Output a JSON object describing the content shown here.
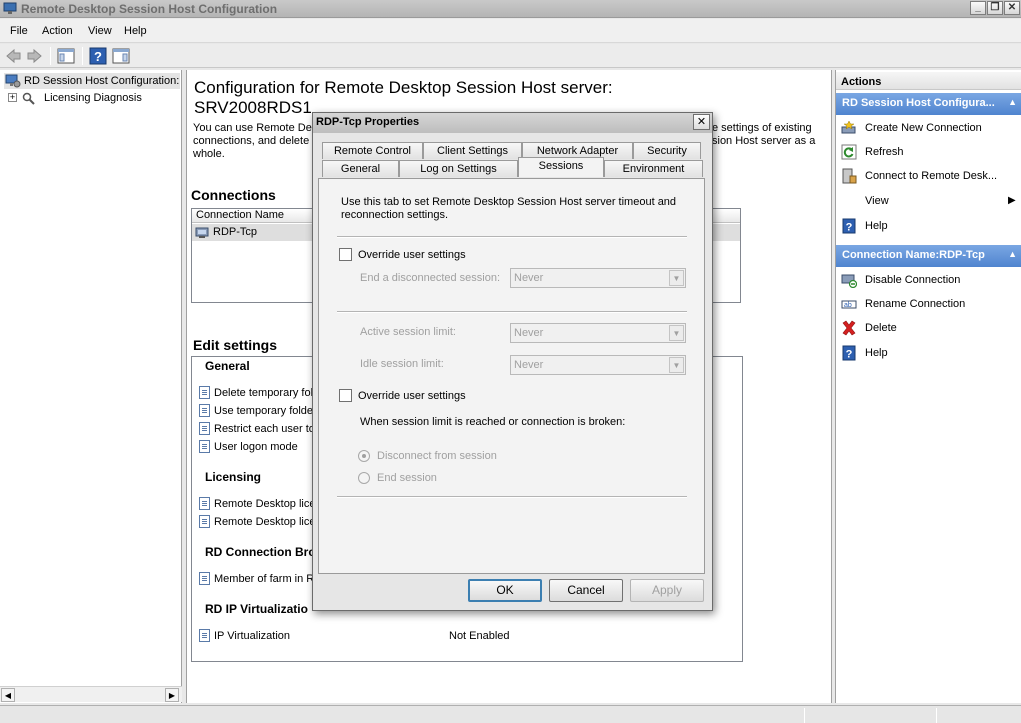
{
  "window": {
    "title": "Remote Desktop Session Host Configuration",
    "buttons": {
      "minimize": "_",
      "restore": "❐",
      "close": "✕"
    }
  },
  "menu": [
    "File",
    "Action",
    "View",
    "Help"
  ],
  "tree": {
    "root": "RD Session Host Configuration:",
    "child": "Licensing Diagnosis"
  },
  "center": {
    "title": "Configuration for Remote Desktop Session Host server:",
    "server": "SRV2008RDS1",
    "desc_left": "You can use Remote De\nconnections, and delete\nwhole.",
    "desc_right": "e settings of existing\nsion Host server as a",
    "connections_heading": "Connections",
    "connections_col": "Connection Name",
    "connection_row": "RDP-Tcp",
    "edit_heading": "Edit settings",
    "groups": [
      {
        "title": "General",
        "items": [
          "Delete temporary fol",
          "Use temporary folder",
          "Restrict each user to",
          "User logon mode"
        ]
      },
      {
        "title": "Licensing",
        "items": [
          "Remote Desktop lice",
          "Remote Desktop lice"
        ]
      },
      {
        "title": "RD Connection Bro",
        "items": [
          "Member of farm in R"
        ]
      },
      {
        "title": "RD IP Virtualizatio",
        "items": [
          "IP Virtualization"
        ]
      }
    ],
    "ip_virtualization_value": "Not Enabled"
  },
  "actions": {
    "header": "Actions",
    "group1": "RD Session Host Configura...",
    "group1_items": [
      "Create New Connection",
      "Refresh",
      "Connect to Remote Desk...",
      "View",
      "Help"
    ],
    "group2": "Connection Name:RDP-Tcp",
    "group2_items": [
      "Disable Connection",
      "Rename Connection",
      "Delete",
      "Help"
    ]
  },
  "dialog": {
    "title": "RDP-Tcp Properties",
    "tabs_row1": [
      "Remote Control",
      "Client Settings",
      "Network Adapter",
      "Security"
    ],
    "tabs_row2": [
      "General",
      "Log on Settings",
      "Sessions",
      "Environment"
    ],
    "active_tab": "Sessions",
    "intro": "Use this tab to set Remote Desktop Session Host server timeout and\nreconnection settings.",
    "override1": "Override user settings",
    "end_disconnected_label": "End a disconnected session:",
    "end_disconnected_value": "Never",
    "active_limit_label": "Active session limit:",
    "active_limit_value": "Never",
    "idle_limit_label": "Idle session limit:",
    "idle_limit_value": "Never",
    "override2": "Override user settings",
    "when_limit": "When session limit is reached or connection is broken:",
    "radio_disconnect": "Disconnect from session",
    "radio_end": "End session",
    "ok": "OK",
    "cancel": "Cancel",
    "apply": "Apply"
  }
}
